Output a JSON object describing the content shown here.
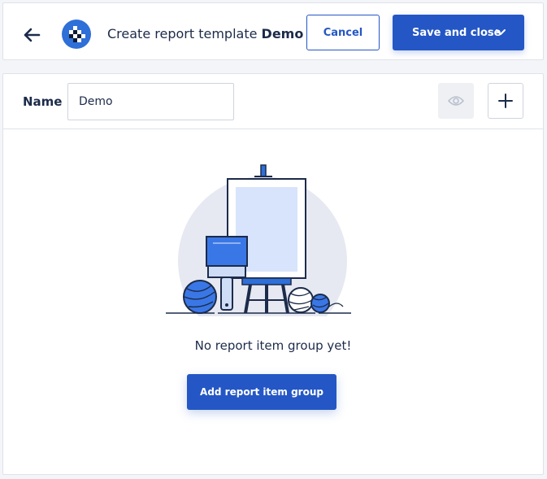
{
  "header": {
    "title_prefix": "Create report template",
    "title_name": "Demo",
    "cancel_label": "Cancel",
    "save_label": "Save and close",
    "back_icon": "arrow-left-icon",
    "logo_icon": "checkered-logo-icon"
  },
  "name_row": {
    "label": "Name",
    "value": "Demo",
    "preview_icon": "eye-icon",
    "add_icon": "plus-icon"
  },
  "empty_state": {
    "message": "No report item group yet!",
    "action_label": "Add report item group",
    "illustration": "easel-paintbrush-yarn-illustration"
  },
  "colors": {
    "primary": "#2457c5",
    "text": "#1c2b4a",
    "border": "#dfe2ea"
  }
}
